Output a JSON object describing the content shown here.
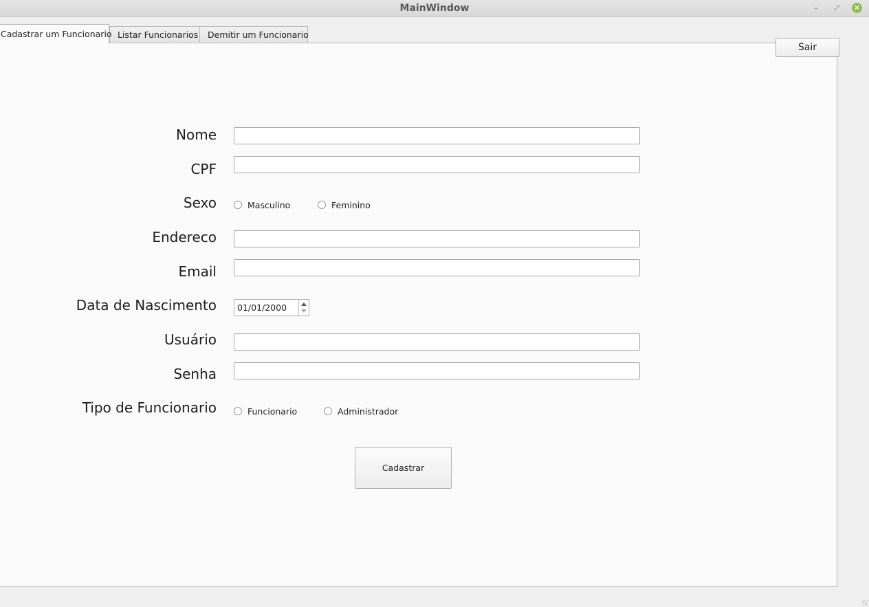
{
  "window": {
    "title": "MainWindow",
    "controls": {
      "minimize": "–",
      "maximize": "⤢",
      "close": "✕"
    }
  },
  "tabs": [
    {
      "label": "Cadastrar um Funcionario",
      "active": true
    },
    {
      "label": "Listar Funcionarios",
      "active": false
    },
    {
      "label": "Demitir um Funcionario",
      "active": false
    }
  ],
  "toolbar": {
    "sair_label": "Sair"
  },
  "form": {
    "nome": {
      "label": "Nome",
      "value": ""
    },
    "cpf": {
      "label": "CPF",
      "value": ""
    },
    "sexo": {
      "label": "Sexo",
      "options": [
        "Masculino",
        "Feminino"
      ],
      "selected": null
    },
    "endereco": {
      "label": "Endereco",
      "value": ""
    },
    "email": {
      "label": "Email",
      "value": ""
    },
    "nascimento": {
      "label": "Data de Nascimento",
      "value": "01/01/2000"
    },
    "usuario": {
      "label": "Usuário",
      "value": ""
    },
    "senha": {
      "label": "Senha",
      "value": ""
    },
    "tipo": {
      "label": "Tipo de Funcionario",
      "options": [
        "Funcionario",
        "Administrador"
      ],
      "selected": null
    },
    "submit_label": "Cadastrar"
  },
  "icons": {
    "radio": "radio-circle-icon",
    "spin_up": "triangle-up-icon",
    "spin_down": "triangle-down-icon",
    "close": "close-icon",
    "minimize": "minimize-icon",
    "maximize": "maximize-icon",
    "resize_grip": "resize-grip-icon"
  },
  "colors": {
    "close_button": "#8cc04e",
    "panel_bg": "#fafafa",
    "window_bg": "#efefef"
  }
}
